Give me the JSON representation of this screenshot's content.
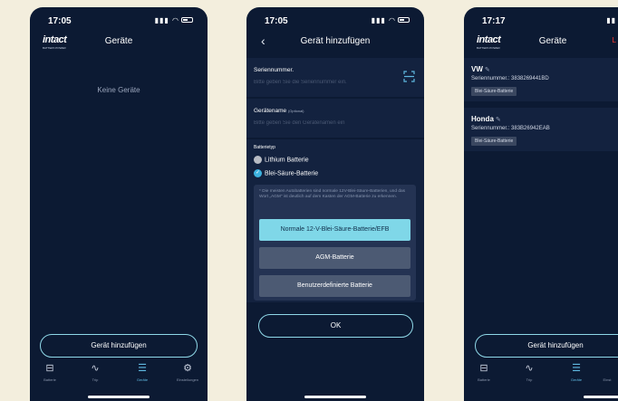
{
  "screens": [
    {
      "status_time": "17:05",
      "logo": "intact",
      "logo_sub": "BATTERY-POWER",
      "title": "Geräte",
      "empty_text": "Keine Geräte",
      "add_button": "Gerät hinzufügen",
      "tabs": [
        {
          "label": "Batterie",
          "icon": "battery-icon"
        },
        {
          "label": "Trip",
          "icon": "trip-icon"
        },
        {
          "label": "Geräte",
          "icon": "devices-icon",
          "active": true
        },
        {
          "label": "Einstellungen",
          "icon": "settings-gear-icon"
        }
      ]
    },
    {
      "status_time": "17:05",
      "title": "Gerät hinzufügen",
      "serial_label": "Seriennummer.",
      "serial_placeholder": "Bitte geben Sie die Seriennummer ein.",
      "name_label": "Gerätename",
      "name_optional": "(Optional)",
      "name_placeholder": "Bitte geben Sie den Gerätenamen ein",
      "battery_type_label": "Batterietyp",
      "radio_options": [
        {
          "label": "Lithium Batterie",
          "selected": false
        },
        {
          "label": "Blei-Säure-Batterie",
          "selected": true
        }
      ],
      "info_text": "* Die meisten Autobatterien sind normale 12V-Blei-Säure-Batterien, und das Wort „AGM\" ist deutlich auf dem Kasten der AGM-Batterie zu erkennen.",
      "choices": [
        {
          "label": "Normale 12-V-Blei-Säure-Batterie/EFB",
          "selected": true
        },
        {
          "label": "AGM-Batterie",
          "selected": false
        },
        {
          "label": "Benutzerdefinierte Batterie",
          "selected": false
        }
      ],
      "ok_button": "OK"
    },
    {
      "status_time": "17:17",
      "logo": "intact",
      "logo_sub": "BATTERY-POWER",
      "title": "Geräte",
      "header_right": "L",
      "devices": [
        {
          "name": "VW",
          "serial": "Seriennummer.: 3838269441BD",
          "badge": "Blei-Säure-Batterie"
        },
        {
          "name": "Honda",
          "serial": "Seriennummer.: 383B26942EAB",
          "badge": "Blei-Säure-Batterie"
        }
      ],
      "add_button": "Gerät hinzufügen",
      "tabs": [
        {
          "label": "Batterie",
          "icon": "battery-icon"
        },
        {
          "label": "Trip",
          "icon": "trip-icon"
        },
        {
          "label": "Geräte",
          "icon": "devices-icon",
          "active": true
        },
        {
          "label": "Einst",
          "icon": "settings-gear-icon"
        }
      ]
    }
  ],
  "colors": {
    "background": "#f3eedd",
    "screen": "#0c1a33",
    "panel": "#13223f",
    "accent": "#7fd7e8",
    "radio_on": "#3db3e0",
    "alert": "#ff3b30"
  }
}
